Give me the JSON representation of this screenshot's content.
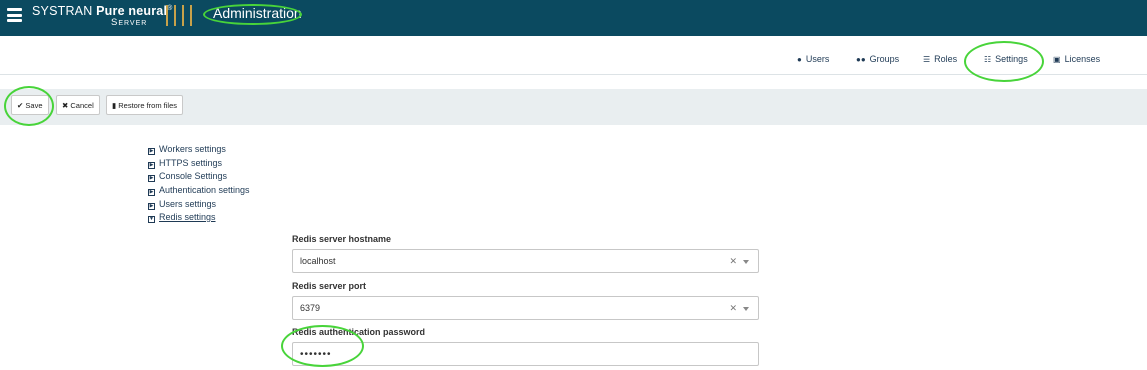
{
  "header": {
    "brand_prefix": "SYSTRAN",
    "brand_bold": "Pure neural",
    "brand_reg": "®",
    "brand_sub": "Server",
    "section_title": "Administration",
    "colors": {
      "bar": "#0b4a60",
      "accent": "#c8a24a",
      "highlight": "#48d43a"
    }
  },
  "tabs": [
    {
      "label": "Users",
      "icon": "user-icon"
    },
    {
      "label": "Groups",
      "icon": "group-icon"
    },
    {
      "label": "Roles",
      "icon": "list-icon"
    },
    {
      "label": "Settings",
      "icon": "sliders-icon",
      "active": true
    },
    {
      "label": "Licenses",
      "icon": "id-card-icon"
    }
  ],
  "toolbar": {
    "save_label": "Save",
    "cancel_label": "Cancel",
    "restore_label": "Restore from files"
  },
  "sections": [
    {
      "label": "Workers settings",
      "expanded": false
    },
    {
      "label": "HTTPS settings",
      "expanded": false
    },
    {
      "label": "Console Settings",
      "expanded": false
    },
    {
      "label": "Authentication settings",
      "expanded": false
    },
    {
      "label": "Users settings",
      "expanded": false
    },
    {
      "label": "Redis settings",
      "expanded": true
    }
  ],
  "redis": {
    "hostname_label": "Redis server hostname",
    "hostname_value": "localhost",
    "port_label": "Redis server port",
    "port_value": "6379",
    "password_label": "Redis authentication password",
    "password_value": "•••••••"
  }
}
